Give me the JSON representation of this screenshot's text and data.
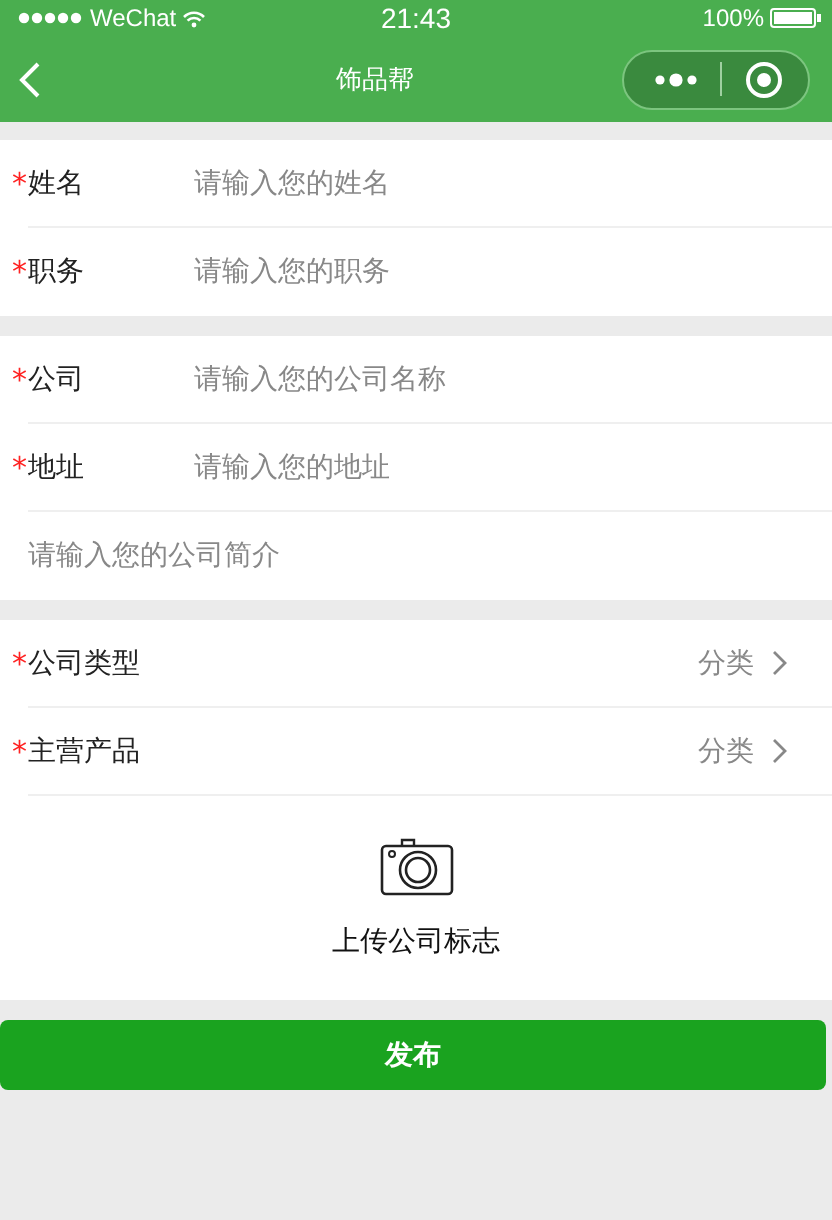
{
  "status_bar": {
    "carrier": "WeChat",
    "time": "21:43",
    "battery": "100%"
  },
  "nav": {
    "title": "饰品帮"
  },
  "sections": [
    {
      "rows": [
        {
          "kind": "field",
          "mark": "*",
          "label": "姓名",
          "placeholder": "请输入您的姓名"
        },
        {
          "kind": "field",
          "mark": "*",
          "label": "职务",
          "placeholder": "请输入您的职务"
        }
      ]
    },
    {
      "rows": [
        {
          "kind": "field",
          "mark": "*",
          "label": "公司",
          "placeholder": "请输入您的公司名称"
        },
        {
          "kind": "field",
          "mark": "*",
          "label": "地址",
          "placeholder": "请输入您的地址"
        },
        {
          "kind": "textarea",
          "placeholder": "请输入您的公司简介"
        }
      ]
    },
    {
      "rows": [
        {
          "kind": "picker",
          "mark": "*",
          "label": "公司类型",
          "value": "分类"
        },
        {
          "kind": "picker",
          "mark": "*",
          "label": "主营产品",
          "value": "分类"
        },
        {
          "kind": "upload",
          "label": "上传公司标志"
        }
      ]
    }
  ],
  "submit": {
    "label": "发布"
  }
}
